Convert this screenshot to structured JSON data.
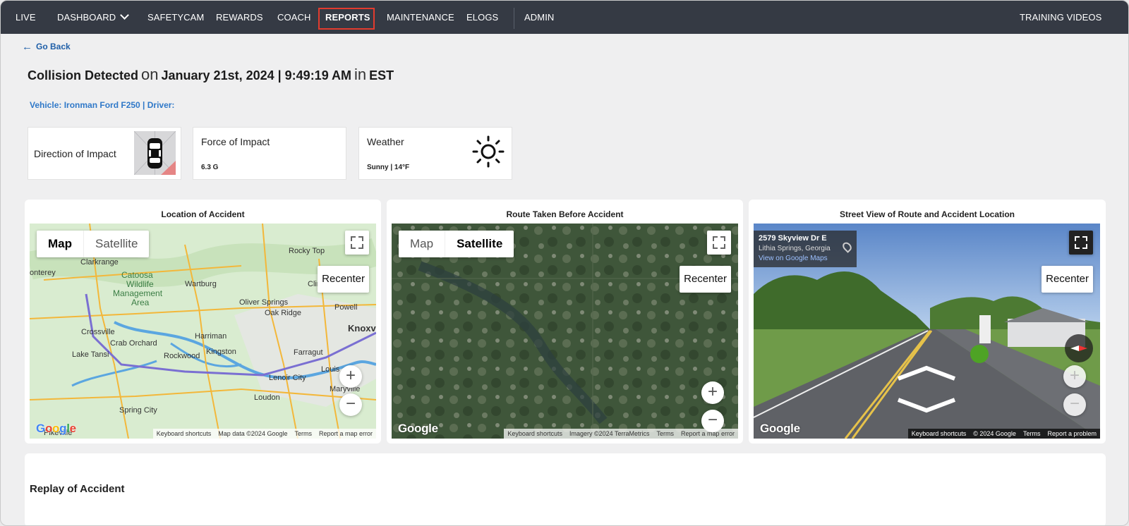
{
  "nav": {
    "items": [
      {
        "label": "LIVE"
      },
      {
        "label": "DASHBOARD"
      },
      {
        "label": "SAFETYCAM"
      },
      {
        "label": "REWARDS"
      },
      {
        "label": "COACH"
      },
      {
        "label": "REPORTS",
        "active": true
      },
      {
        "label": "MAINTENANCE"
      },
      {
        "label": "ELOGS"
      },
      {
        "label": "ADMIN"
      }
    ],
    "right": "TRAINING VIDEOS",
    "active_color": "#e23b2e",
    "bg_color": "#353a44"
  },
  "go_back": "Go Back",
  "header": {
    "event": "Collision Detected",
    "on": "on",
    "datetime": "January 21st, 2024 | 9:49:19 AM",
    "in": "in",
    "tz": "EST"
  },
  "vehicle_line": "Vehicle: Ironman Ford F250 | Driver:",
  "cards": {
    "direction": {
      "label": "Direction of Impact",
      "icon": "car-impact-diagram-icon"
    },
    "force": {
      "label": "Force of Impact",
      "value": "6.3 G"
    },
    "weather": {
      "label": "Weather",
      "value": "Sunny | 14°F",
      "icon": "sun-icon"
    }
  },
  "panels": {
    "location": {
      "title": "Location of Accident",
      "map_type": [
        "Map",
        "Satellite"
      ],
      "selected": "Map",
      "recenter": "Recenter",
      "labels": [
        "Clarkrange",
        "onterey",
        "Catoosa",
        "Wildlife",
        "Management",
        "Area",
        "Wartburg",
        "Rocky Top",
        "Clin",
        "Oliver Springs",
        "Oak Ridge",
        "Powell",
        "Knoxv",
        "Crossville",
        "Crab Orchard",
        "Harriman",
        "Kingston",
        "Farragut",
        "Louis",
        "Lake Tansi",
        "Rockwood",
        "Lenoir City",
        "Maryville",
        "Loudon",
        "Spring City",
        "Pikeville"
      ],
      "attribution": [
        "Keyboard shortcuts",
        "Map data ©2024 Google",
        "Terms",
        "Report a map error"
      ],
      "logo": "Google"
    },
    "route": {
      "title": "Route Taken Before Accident",
      "map_type": [
        "Map",
        "Satellite"
      ],
      "selected": "Satellite",
      "recenter": "Recenter",
      "attribution": [
        "Keyboard shortcuts",
        "Imagery ©2024 TerraMetrics",
        "Terms",
        "Report a map error"
      ],
      "logo": "Google"
    },
    "street": {
      "title": "Street View of Route and Accident Location",
      "address": "2579 Skyview Dr E",
      "locality": "Lithia Springs, Georgia",
      "view_link": "View on Google Maps",
      "recenter": "Recenter",
      "attribution": [
        "Keyboard shortcuts",
        "© 2024 Google",
        "Terms",
        "Report a problem"
      ],
      "logo": "Google"
    }
  },
  "replay": {
    "title": "Replay of Accident"
  }
}
